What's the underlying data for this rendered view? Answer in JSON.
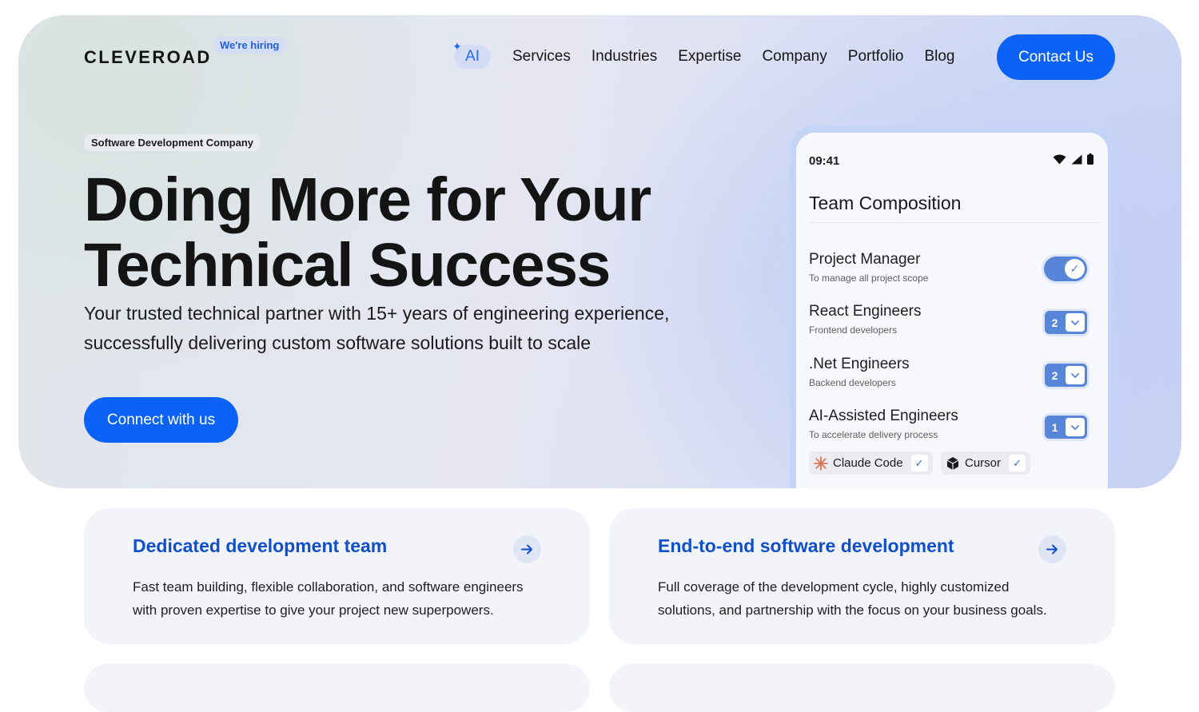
{
  "header": {
    "logo": "CLEVEROAD",
    "hiring_badge": "We're hiring",
    "nav": {
      "ai": "AI",
      "items": [
        "Services",
        "Industries",
        "Expertise",
        "Company",
        "Portfolio",
        "Blog"
      ]
    },
    "contact_button": "Contact Us"
  },
  "hero": {
    "eyebrow": "Software Development Company",
    "headline_line1": "Doing More for Your",
    "headline_line2": "Technical Success",
    "subline_line1": "Your trusted technical partner with 15+ years of engineering experience,",
    "subline_line2": "successfully delivering custom software solutions built to scale",
    "cta": "Connect with us"
  },
  "phone": {
    "time": "09:41",
    "title": "Team Composition",
    "roles": [
      {
        "title": "Project Manager",
        "subtitle": "To manage all project scope",
        "control": "toggle",
        "enabled": true
      },
      {
        "title": "React Engineers",
        "subtitle": "Frontend developers",
        "count": "2"
      },
      {
        "title": ".Net Engineers",
        "subtitle": "Backend developers",
        "count": "2"
      },
      {
        "title": "AI-Assisted Engineers",
        "subtitle": "To accelerate delivery process",
        "count": "1"
      }
    ],
    "tools": [
      {
        "name": "Claude Code",
        "checked": true
      },
      {
        "name": "Cursor",
        "checked": true
      }
    ]
  },
  "cards": [
    {
      "title": "Dedicated development team",
      "text_line1": "Fast team building, flexible collaboration, and software engineers",
      "text_line2": "with proven expertise to give your project new superpowers."
    },
    {
      "title": "End-to-end software development",
      "text_line1": "Full coverage of the development cycle, highly customized",
      "text_line2": "solutions, and partnership with the focus on your business goals."
    }
  ],
  "colors": {
    "accent": "#0c62f6",
    "card_title": "#0f4fc9",
    "toggle": "#5785d8"
  }
}
